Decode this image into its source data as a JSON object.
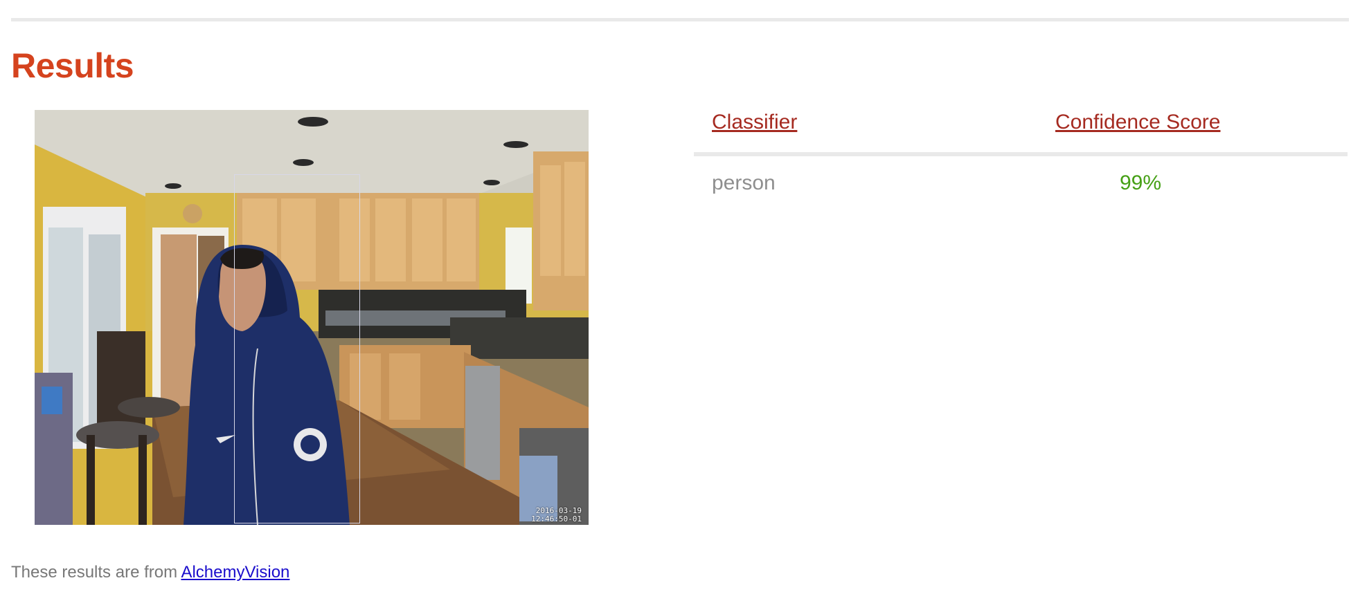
{
  "page": {
    "title": "Results"
  },
  "image": {
    "alt": "person in a kitchen",
    "timestamp_date": "2016-03-19",
    "timestamp_time": "12:46:50-01"
  },
  "table": {
    "headers": {
      "classifier": "Classifier",
      "score": "Confidence Score"
    },
    "rows": [
      {
        "classifier": "person",
        "score": "99%"
      }
    ]
  },
  "footer": {
    "prefix": "These results are from ",
    "link_label": "AlchemyVision"
  },
  "colors": {
    "title": "#d5431e",
    "header_link": "#a52a20",
    "score": "#46a016",
    "muted_text": "#8e8e8e",
    "link": "#1a0dcc"
  }
}
